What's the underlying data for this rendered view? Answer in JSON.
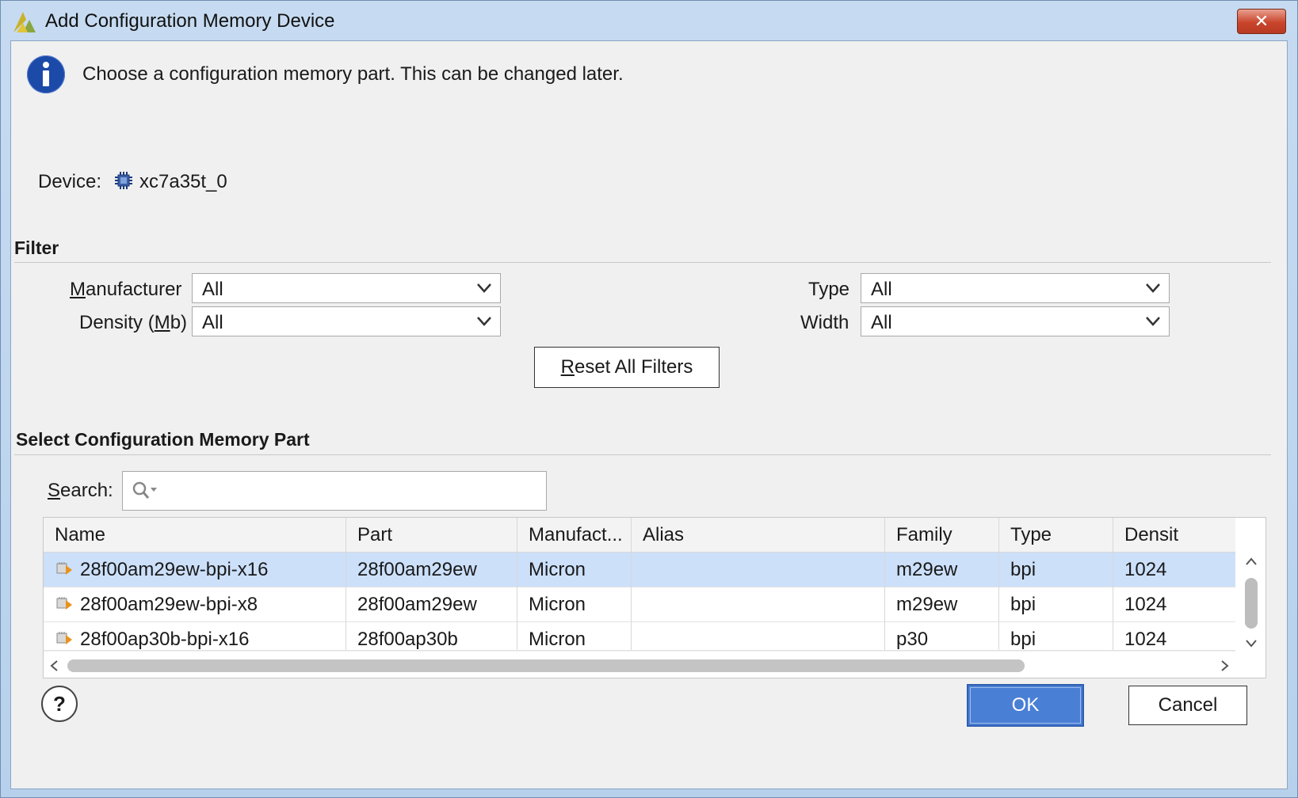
{
  "window": {
    "title": "Add Configuration Memory Device",
    "close_label": "✕"
  },
  "info": {
    "message": "Choose a configuration memory part. This can be changed later."
  },
  "device": {
    "label": "Device:",
    "value": "xc7a35t_0"
  },
  "filter": {
    "section_title": "Filter",
    "manufacturer": {
      "label_pre": "",
      "label_mnemonic": "M",
      "label_post": "anufacturer",
      "value": "All"
    },
    "density": {
      "label_pre": "Density (",
      "label_mnemonic": "M",
      "label_post": "b)",
      "value": "All"
    },
    "type": {
      "label": "Type",
      "value": "All"
    },
    "width": {
      "label": "Width",
      "value": "All"
    },
    "reset": {
      "mnemonic": "R",
      "rest": "eset All Filters"
    }
  },
  "select_part": {
    "section_title": "Select Configuration Memory Part",
    "search": {
      "mnemonic": "S",
      "rest": "earch:",
      "value": "",
      "placeholder": ""
    },
    "columns": [
      "Name",
      "Part",
      "Manufact...",
      "Alias",
      "Family",
      "Type",
      "Densit"
    ],
    "rows": [
      {
        "name": "28f00am29ew-bpi-x16",
        "part": "28f00am29ew",
        "manufacturer": "Micron",
        "alias": "",
        "family": "m29ew",
        "type": "bpi",
        "density": "1024",
        "selected": true
      },
      {
        "name": "28f00am29ew-bpi-x8",
        "part": "28f00am29ew",
        "manufacturer": "Micron",
        "alias": "",
        "family": "m29ew",
        "type": "bpi",
        "density": "1024",
        "selected": false
      },
      {
        "name": "28f00ap30b-bpi-x16",
        "part": "28f00ap30b",
        "manufacturer": "Micron",
        "alias": "",
        "family": "p30",
        "type": "bpi",
        "density": "1024",
        "selected": false
      }
    ]
  },
  "buttons": {
    "help": "?",
    "ok": "OK",
    "cancel": "Cancel"
  },
  "colors": {
    "selected_row": "#cce0fa",
    "ok_button": "#4a7fd6",
    "info_icon": "#1c4aa8",
    "close_button": "#c9452c"
  },
  "icons": {
    "app": "vivado-logo-icon",
    "info": "info-icon",
    "device": "chip-icon",
    "part": "memory-part-icon",
    "search": "search-icon",
    "dropdown": "chevron-down-icon",
    "help": "help-icon"
  }
}
